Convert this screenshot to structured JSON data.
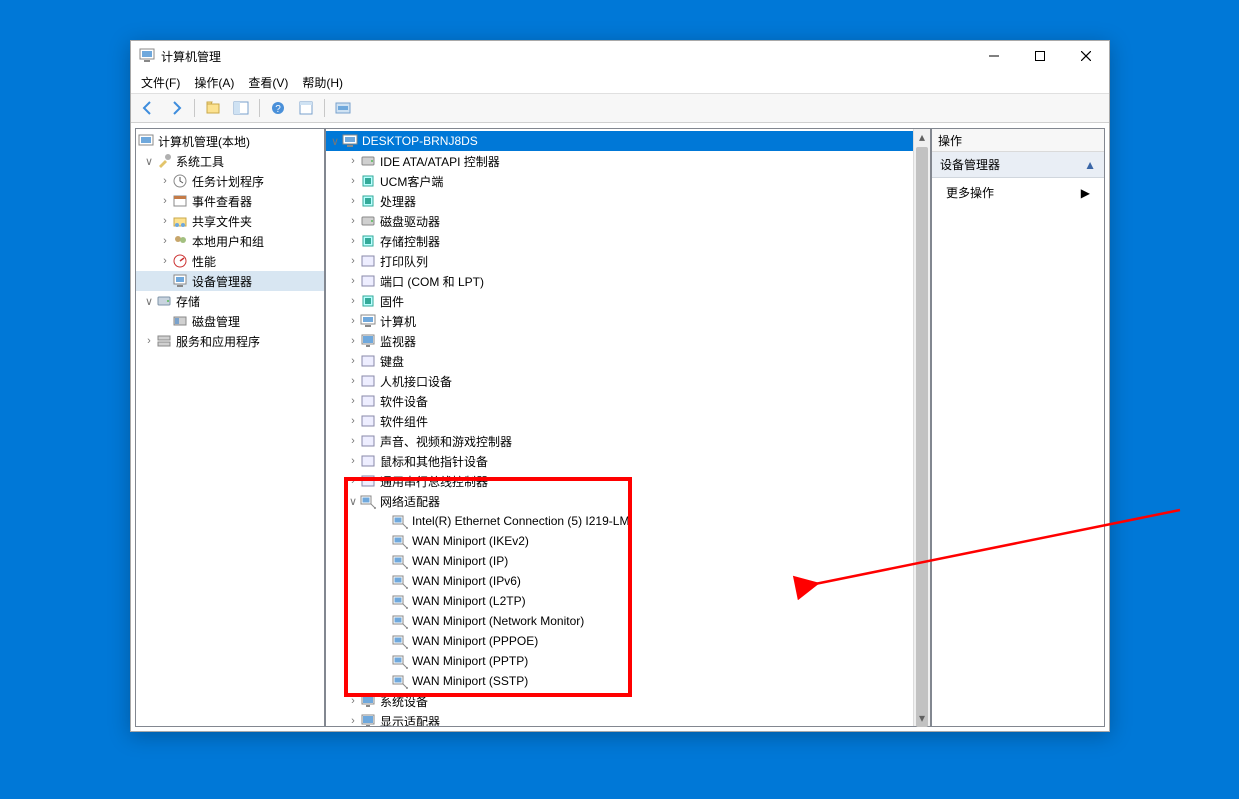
{
  "window": {
    "title": "计算机管理"
  },
  "menu": [
    "文件(F)",
    "操作(A)",
    "查看(V)",
    "帮助(H)"
  ],
  "left_tree": {
    "root": "计算机管理(本地)",
    "system_tools": {
      "label": "系统工具",
      "children": [
        "任务计划程序",
        "事件查看器",
        "共享文件夹",
        "本地用户和组",
        "性能",
        "设备管理器"
      ]
    },
    "storage": {
      "label": "存储",
      "children": [
        "磁盘管理"
      ]
    },
    "services": {
      "label": "服务和应用程序"
    }
  },
  "center_tree": {
    "root": "DESKTOP-BRNJ8DS",
    "cat": [
      "IDE ATA/ATAPI 控制器",
      "UCM客户端",
      "处理器",
      "磁盘驱动器",
      "存储控制器",
      "打印队列",
      "端口 (COM 和 LPT)",
      "固件",
      "计算机",
      "监视器",
      "键盘",
      "人机接口设备",
      "软件设备",
      "软件组件",
      "声音、视频和游戏控制器",
      "鼠标和其他指针设备",
      "通用串行总线控制器",
      "网络适配器",
      "系统设备",
      "显示适配器"
    ],
    "net_children": [
      "Intel(R) Ethernet Connection (5) I219-LM",
      "WAN Miniport (IKEv2)",
      "WAN Miniport (IP)",
      "WAN Miniport (IPv6)",
      "WAN Miniport (L2TP)",
      "WAN Miniport (Network Monitor)",
      "WAN Miniport (PPPOE)",
      "WAN Miniport (PPTP)",
      "WAN Miniport (SSTP)"
    ]
  },
  "actions": {
    "header": "操作",
    "section": "设备管理器",
    "more": "更多操作"
  }
}
